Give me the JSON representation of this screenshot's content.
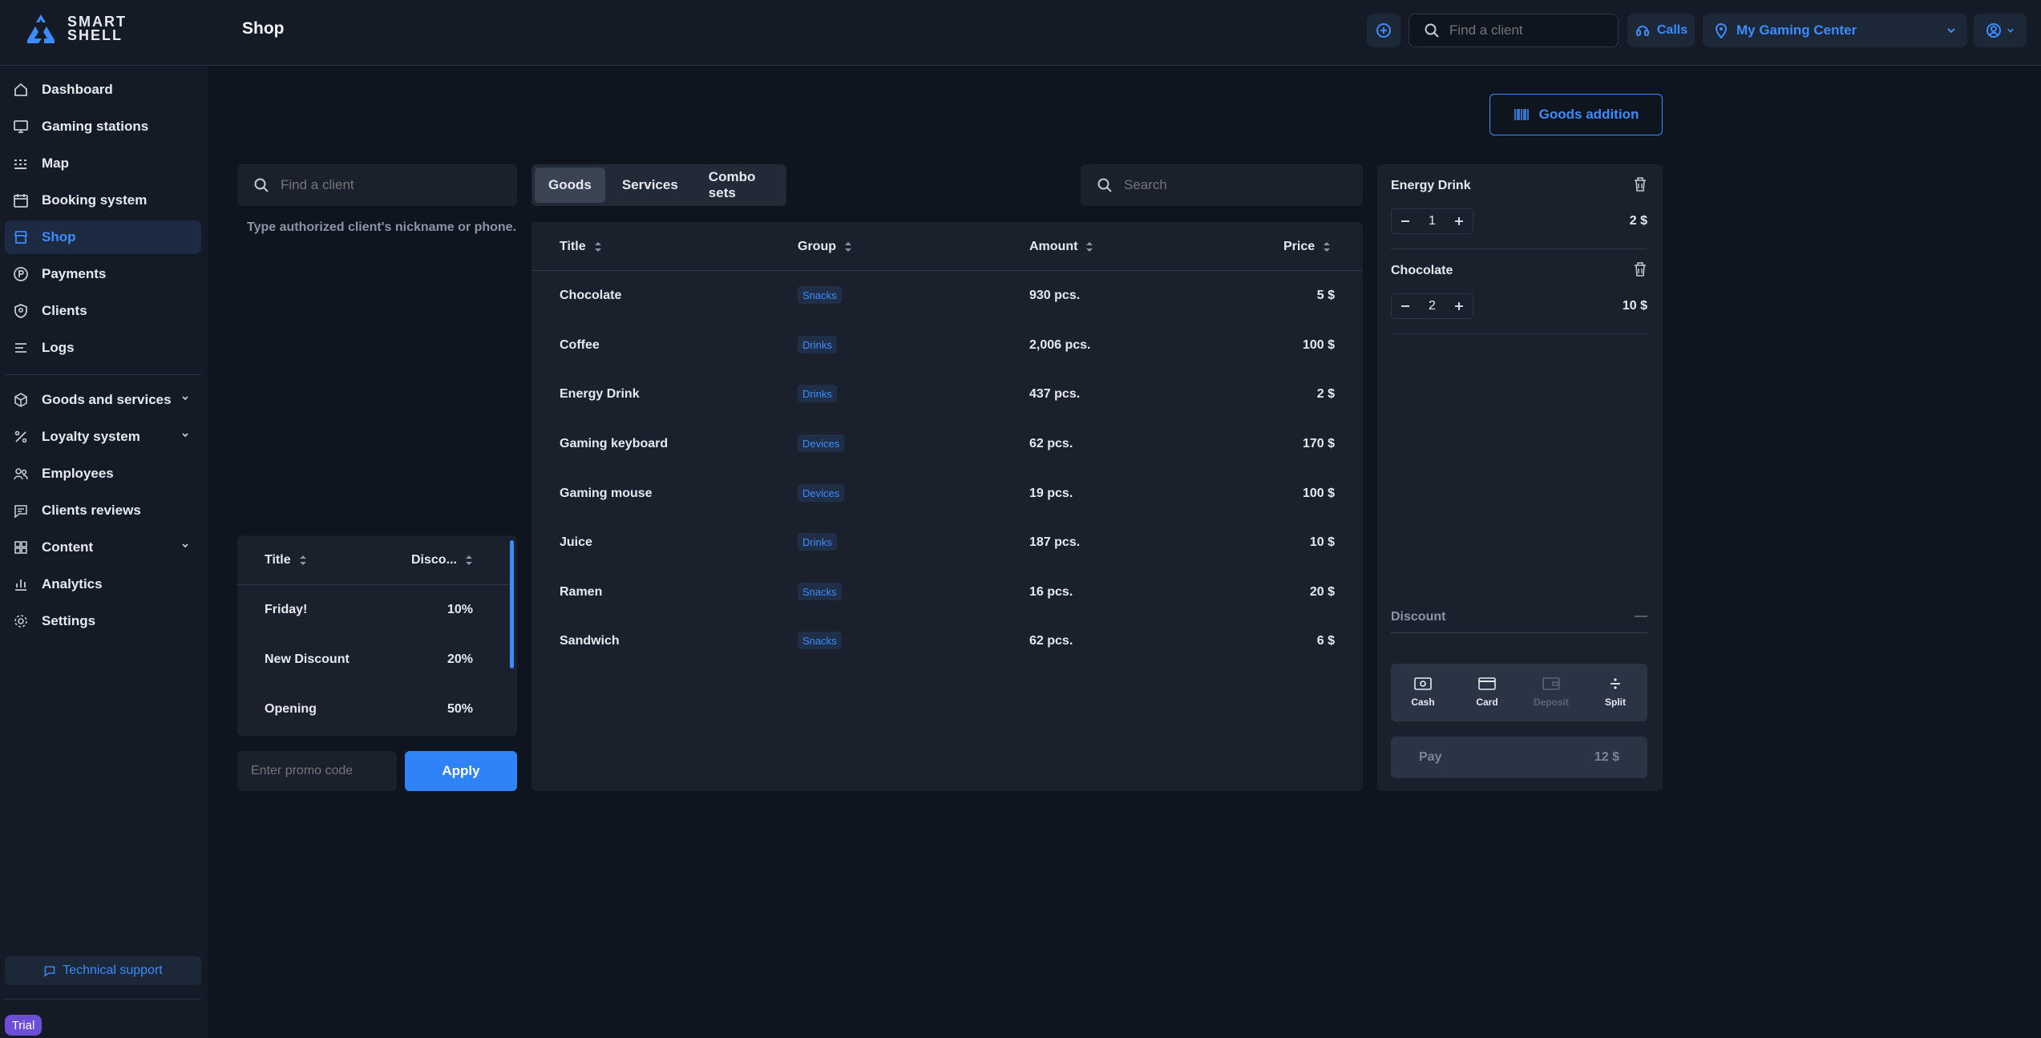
{
  "app": {
    "logo_line1": "SMART",
    "logo_line2": "SHELL",
    "page_title": "Shop"
  },
  "topbar": {
    "search_placeholder": "Find a client",
    "calls_label": "Calls",
    "center_name": "My Gaming Center"
  },
  "sidebar": {
    "items": [
      {
        "label": "Dashboard",
        "icon": "home-icon"
      },
      {
        "label": "Gaming stations",
        "icon": "monitor-icon"
      },
      {
        "label": "Map",
        "icon": "grid-dots-icon"
      },
      {
        "label": "Booking system",
        "icon": "calendar-icon"
      },
      {
        "label": "Shop",
        "icon": "store-icon",
        "active": true
      },
      {
        "label": "Payments",
        "icon": "coin-icon"
      },
      {
        "label": "Clients",
        "icon": "user-shield-icon"
      },
      {
        "label": "Logs",
        "icon": "list-icon"
      }
    ],
    "items2": [
      {
        "label": "Goods and services",
        "icon": "box-icon",
        "expandable": true
      },
      {
        "label": "Loyalty system",
        "icon": "percent-icon",
        "expandable": true
      },
      {
        "label": "Employees",
        "icon": "users-icon"
      },
      {
        "label": "Clients reviews",
        "icon": "chat-icon"
      },
      {
        "label": "Content",
        "icon": "layout-icon",
        "expandable": true
      },
      {
        "label": "Analytics",
        "icon": "bar-chart-icon"
      },
      {
        "label": "Settings",
        "icon": "gear-icon"
      }
    ],
    "support_label": "Technical support",
    "trial_label": "Trial"
  },
  "main": {
    "goods_addition_label": "Goods addition",
    "client_search_placeholder": "Find a client",
    "client_hint": "Type authorized client's nickname or phone.",
    "tabs": [
      {
        "label": "Goods",
        "active": true
      },
      {
        "label": "Services"
      },
      {
        "label": "Combo sets"
      }
    ],
    "goods_search_placeholder": "Search",
    "goods_columns": {
      "title": "Title",
      "group": "Group",
      "amount": "Amount",
      "price": "Price"
    },
    "goods": [
      {
        "title": "Chocolate",
        "group": "Snacks",
        "amount": "930 pcs.",
        "price": "5 $"
      },
      {
        "title": "Coffee",
        "group": "Drinks",
        "amount": "2,006 pcs.",
        "price": "100 $"
      },
      {
        "title": "Energy Drink",
        "group": "Drinks",
        "amount": "437 pcs.",
        "price": "2 $"
      },
      {
        "title": "Gaming keyboard",
        "group": "Devices",
        "amount": "62 pcs.",
        "price": "170 $"
      },
      {
        "title": "Gaming mouse",
        "group": "Devices",
        "amount": "19 pcs.",
        "price": "100 $"
      },
      {
        "title": "Juice",
        "group": "Drinks",
        "amount": "187 pcs.",
        "price": "10 $"
      },
      {
        "title": "Ramen",
        "group": "Snacks",
        "amount": "16 pcs.",
        "price": "20 $"
      },
      {
        "title": "Sandwich",
        "group": "Snacks",
        "amount": "62 pcs.",
        "price": "6 $"
      }
    ],
    "discount_columns": {
      "title": "Title",
      "discount": "Disco..."
    },
    "discounts": [
      {
        "title": "Friday!",
        "value": "10%"
      },
      {
        "title": "New Discount",
        "value": "20%"
      },
      {
        "title": "Opening",
        "value": "50%"
      }
    ],
    "promo_placeholder": "Enter promo code",
    "apply_label": "Apply"
  },
  "cart": {
    "items": [
      {
        "name": "Energy Drink",
        "qty": "1",
        "sum": "2 $"
      },
      {
        "name": "Chocolate",
        "qty": "2",
        "sum": "10 $"
      }
    ],
    "discount_label": "Discount",
    "discount_value": "—",
    "payment_methods": [
      {
        "label": "Cash",
        "icon": "cash-icon",
        "enabled": true
      },
      {
        "label": "Card",
        "icon": "card-icon",
        "enabled": true
      },
      {
        "label": "Deposit",
        "icon": "wallet-icon",
        "enabled": false
      },
      {
        "label": "Split",
        "icon": "divide-icon",
        "enabled": true
      }
    ],
    "pay_label": "Pay",
    "pay_total": "12 $"
  },
  "colors": {
    "accent": "#3d8bfd",
    "background": "#0f151f",
    "panel": "#1a212d",
    "trial": "#6c4fd6"
  }
}
